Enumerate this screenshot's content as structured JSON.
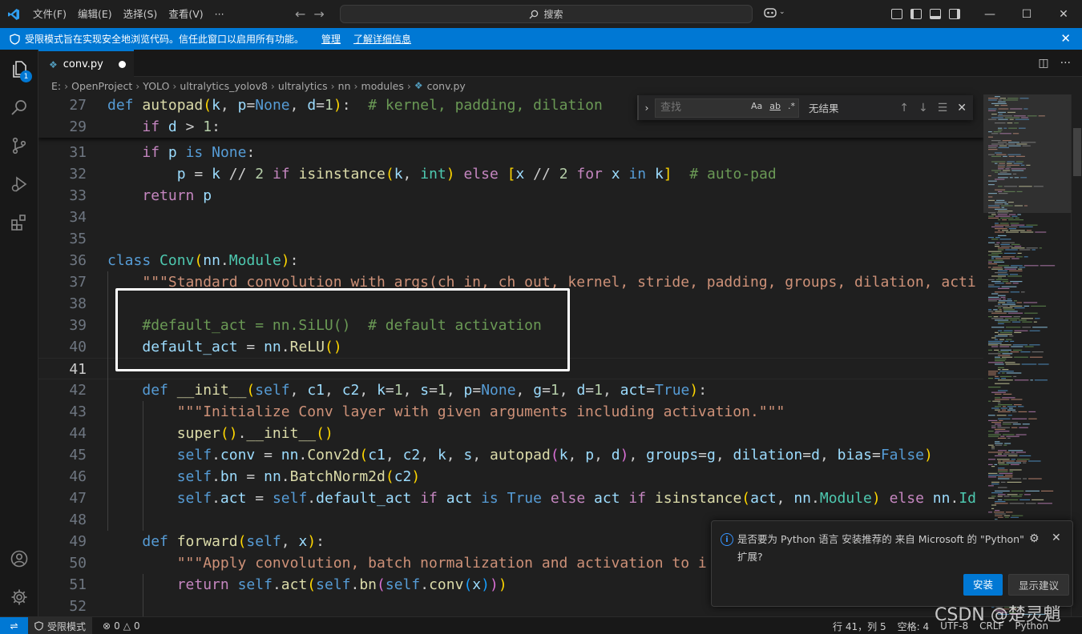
{
  "titlebar": {
    "menus": [
      "文件(F)",
      "编辑(E)",
      "选择(S)",
      "查看(V)"
    ],
    "more": "···",
    "search": "搜索"
  },
  "banner": {
    "message": "受限模式旨在实现安全地浏览代码。信任此窗口以启用所有功能。",
    "manage": "管理",
    "learn_more": "了解详细信息"
  },
  "activity": {
    "explorer_badge": "1"
  },
  "tab": {
    "filename": "conv.py"
  },
  "breadcrumb": [
    "E:",
    "OpenProject",
    "YOLO",
    "ultralytics_yolov8",
    "ultralytics",
    "nn",
    "modules",
    "conv.py"
  ],
  "find": {
    "placeholder": "查找",
    "result": "无结果",
    "opt_case": "Aa",
    "opt_word": "ab",
    "opt_regex": ".*"
  },
  "editor": {
    "current_line": 41,
    "sticky": [
      {
        "n": "27",
        "code": "def autopad(k, p=None, d=1):  # kernel, padding, dilation"
      },
      {
        "n": "29",
        "code": "    if d > 1:"
      }
    ],
    "lines": [
      {
        "n": "31",
        "code": "    if p is None:"
      },
      {
        "n": "32",
        "code": "        p = k // 2 if isinstance(k, int) else [x // 2 for x in k]  # auto-pad"
      },
      {
        "n": "33",
        "code": "    return p"
      },
      {
        "n": "34",
        "code": ""
      },
      {
        "n": "35",
        "code": ""
      },
      {
        "n": "36",
        "code": "class Conv(nn.Module):"
      },
      {
        "n": "37",
        "code": "    \"\"\"Standard convolution with args(ch_in, ch_out, kernel, stride, padding, groups, dilation, acti"
      },
      {
        "n": "38",
        "code": ""
      },
      {
        "n": "39",
        "code": "    #default_act = nn.SiLU()  # default activation"
      },
      {
        "n": "40",
        "code": "    default_act = nn.ReLU()"
      },
      {
        "n": "41",
        "code": ""
      },
      {
        "n": "42",
        "code": "    def __init__(self, c1, c2, k=1, s=1, p=None, g=1, d=1, act=True):"
      },
      {
        "n": "43",
        "code": "        \"\"\"Initialize Conv layer with given arguments including activation.\"\"\""
      },
      {
        "n": "44",
        "code": "        super().__init__()"
      },
      {
        "n": "45",
        "code": "        self.conv = nn.Conv2d(c1, c2, k, s, autopad(k, p, d), groups=g, dilation=d, bias=False)"
      },
      {
        "n": "46",
        "code": "        self.bn = nn.BatchNorm2d(c2)"
      },
      {
        "n": "47",
        "code": "        self.act = self.default_act if act is True else act if isinstance(act, nn.Module) else nn.Id"
      },
      {
        "n": "48",
        "code": ""
      },
      {
        "n": "49",
        "code": "    def forward(self, x):"
      },
      {
        "n": "50",
        "code": "        \"\"\"Apply convolution, batch normalization and activation to i"
      },
      {
        "n": "51",
        "code": "        return self.act(self.bn(self.conv(x)))"
      },
      {
        "n": "52",
        "code": ""
      }
    ]
  },
  "notification": {
    "message": "是否要为 Python 语言 安装推荐的 来自 Microsoft 的 \"Python\" 扩展?",
    "install": "安装",
    "show_recommendations": "显示建议"
  },
  "statusbar": {
    "restricted_mode": "受限模式",
    "errors": "0",
    "warnings": "0",
    "position": "行 41，列 5",
    "spaces": "空格: 4",
    "encoding": "UTF-8",
    "eol": "CRLF",
    "language": "Python"
  },
  "watermark": "CSDN @楚灵魈",
  "colors": {
    "accent": "#0078d4",
    "keyword": "#569cd6",
    "control": "#c586c0",
    "function": "#dcdcaa",
    "string": "#ce9178",
    "comment": "#6a9955"
  }
}
